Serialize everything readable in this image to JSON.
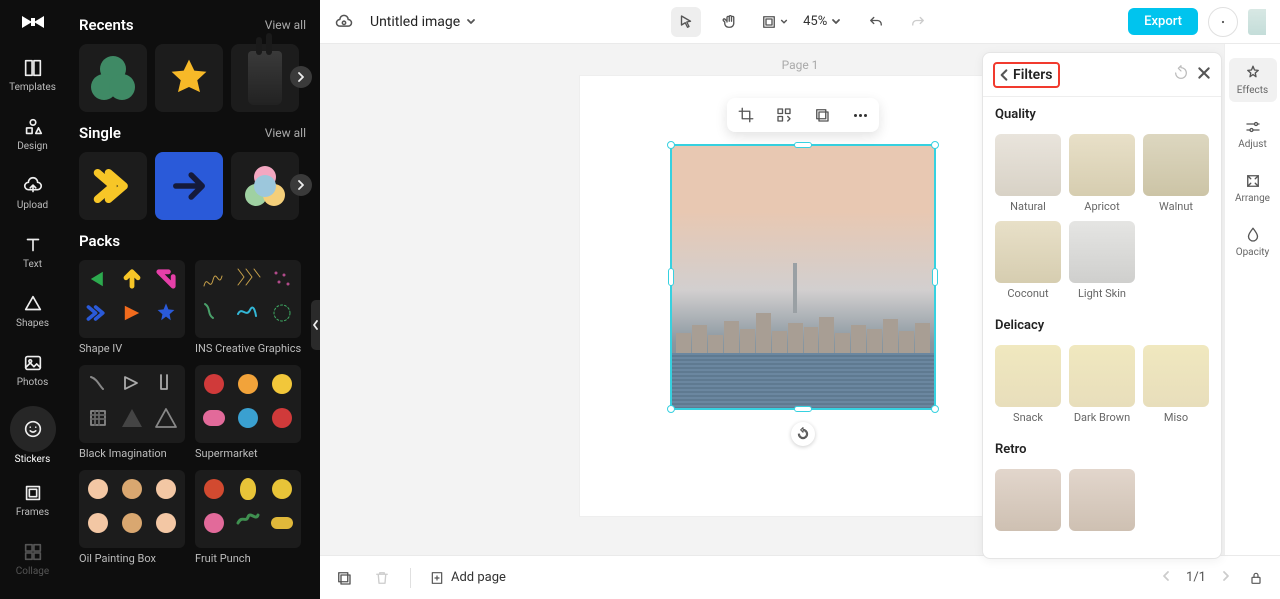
{
  "leftRail": {
    "items": [
      {
        "label": "Templates",
        "icon": "templates"
      },
      {
        "label": "Design",
        "icon": "design"
      },
      {
        "label": "Upload",
        "icon": "upload"
      },
      {
        "label": "Text",
        "icon": "text"
      },
      {
        "label": "Shapes",
        "icon": "shapes"
      },
      {
        "label": "Photos",
        "icon": "photos"
      },
      {
        "label": "Stickers",
        "icon": "stickers"
      },
      {
        "label": "Frames",
        "icon": "frames"
      },
      {
        "label": "Collage",
        "icon": "collage"
      }
    ]
  },
  "assets": {
    "recents": {
      "title": "Recents",
      "viewAll": "View all"
    },
    "single": {
      "title": "Single",
      "viewAll": "View all"
    },
    "packs": {
      "title": "Packs",
      "items": [
        {
          "label": "Shape IV"
        },
        {
          "label": "INS Creative Graphics"
        },
        {
          "label": "Black Imagination"
        },
        {
          "label": "Supermarket"
        },
        {
          "label": "Oil Painting Box"
        },
        {
          "label": "Fruit Punch"
        }
      ]
    }
  },
  "topbar": {
    "title": "Untitled image",
    "zoom": "45%",
    "export": "Export"
  },
  "canvas": {
    "pageLabel": "Page 1"
  },
  "bottombar": {
    "addPage": "Add page",
    "pageIndicator": "1/1"
  },
  "filters": {
    "title": "Filters",
    "sections": {
      "quality": {
        "title": "Quality",
        "items": [
          "Natural",
          "Apricot",
          "Walnut",
          "Coconut",
          "Light Skin"
        ]
      },
      "delicacy": {
        "title": "Delicacy",
        "items": [
          "Snack",
          "Dark Brown",
          "Miso"
        ]
      },
      "retro": {
        "title": "Retro"
      }
    }
  },
  "rightRail": {
    "items": [
      {
        "label": "Effects"
      },
      {
        "label": "Adjust"
      },
      {
        "label": "Arrange"
      },
      {
        "label": "Opacity"
      }
    ]
  }
}
